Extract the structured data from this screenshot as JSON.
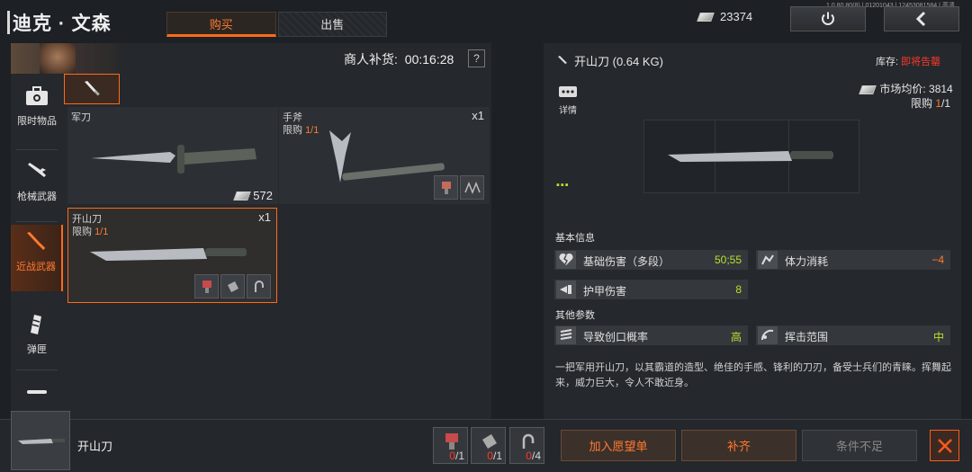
{
  "header": {
    "merchant_name": "迪克 · 文森",
    "tabs": [
      {
        "label": "购买",
        "active": true
      },
      {
        "label": "出售",
        "active": false
      }
    ],
    "currency_amount": "23374",
    "version": "1.0.80.80(8) | 01201043 | 12453081584 | 高清"
  },
  "left_panel": {
    "restock_label": "商人补货:",
    "restock_timer": "00:16:28",
    "help_label": "?",
    "categories": [
      {
        "label": "限时物品",
        "icon": "briefcase-icon",
        "active": false
      },
      {
        "label": "枪械武器",
        "icon": "rifle-icon",
        "active": false
      },
      {
        "label": "近战武器",
        "icon": "knife-icon",
        "active": true
      },
      {
        "label": "弹匣",
        "icon": "magazine-icon",
        "active": false
      }
    ],
    "items": [
      {
        "name": "军刀",
        "price": "572",
        "icon": "bayonet-icon"
      },
      {
        "name": "手斧",
        "limit_label": "限购",
        "limit_value": "1/1",
        "qty": "x1",
        "icon": "hatchet-icon"
      },
      {
        "name": "开山刀",
        "limit_label": "限购",
        "limit_value": "1/1",
        "qty": "x1",
        "icon": "machete-icon",
        "selected": true
      }
    ]
  },
  "detail": {
    "item_name": "开山刀 (0.64 KG)",
    "stock_label": "库存:",
    "stock_value": "即将告罄",
    "details_label": "详情",
    "market_price_label": "市场均价:",
    "market_price": "3814",
    "limit_label": "限购",
    "limit_value": "1",
    "limit_total": "/1",
    "rarity_dots": "▪▪▪",
    "basic_info_title": "基本信息",
    "other_params_title": "其他参数",
    "stats": [
      {
        "label": "基础伤害（多段）",
        "value": "50;55",
        "color": "#b8e030"
      },
      {
        "label": "体力消耗",
        "value": "−4",
        "color": "#ff7a30"
      },
      {
        "label": "护甲伤害",
        "value": "8",
        "color": "#b8e030"
      },
      {
        "label": "导致创口概率",
        "value": "高",
        "color": "#b8e030"
      },
      {
        "label": "挥击范围",
        "value": "中",
        "color": "#b8e030"
      }
    ],
    "description": "一把军用开山刀，以其霸道的造型、绝佳的手感、锋利的刀刃，备受士兵们的青睐。挥舞起来，威力巨大，令人不敢近身。"
  },
  "bottom": {
    "selected_item_name": "开山刀",
    "requirements": [
      {
        "icon": "drill-icon",
        "have": "0",
        "need": "/1"
      },
      {
        "icon": "cloth-icon",
        "have": "0",
        "need": "/1"
      },
      {
        "icon": "hook-icon",
        "have": "0",
        "need": "/4"
      }
    ],
    "wishlist_label": "加入愿望单",
    "restock_label": "补齐",
    "condition_label": "条件不足"
  }
}
